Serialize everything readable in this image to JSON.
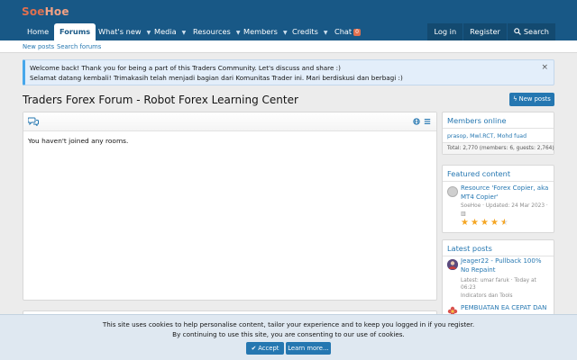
{
  "site": {
    "logo_primary": "Soe",
    "logo_secondary": "Hoe"
  },
  "nav": {
    "items": [
      {
        "label": "Home"
      },
      {
        "label": "Forums",
        "active": true
      },
      {
        "label": "What's new"
      },
      {
        "label": "Media"
      },
      {
        "label": "Resources"
      },
      {
        "label": "Members"
      },
      {
        "label": "Credits"
      },
      {
        "label": "Chat",
        "badge": "0"
      }
    ],
    "login": "Log in",
    "register": "Register",
    "search": "Search"
  },
  "subnav": {
    "new_posts": "New posts",
    "search_forums": "Search forums"
  },
  "notice": {
    "line1": "Welcome back! Thank you for being a part of this Traders Community. Let's discuss and share :)",
    "line2": "Selamat datang kembali! Trimakasih telah menjadi bagian dari Komunitas Trader ini. Mari berdiskusi dan berbagi :)",
    "close": "×"
  },
  "page": {
    "title": "Traders Forex Forum - Robot Forex Learning Center",
    "new_posts_button": "New posts"
  },
  "chat": {
    "message": "You haven't joined any rooms."
  },
  "sidebar": {
    "members_online": {
      "title": "Members online",
      "members": "prasop, Mwl.RCT, Mohd fuad",
      "total": "Total: 2,770 (members: 6, guests: 2,764)"
    },
    "featured": {
      "title": "Featured content",
      "item_title": "Resource 'Forex Copier, aka MT4 Copier'",
      "item_meta": "SoeHoe · Updated: 24 Mar 2023 ·",
      "rating_stars": 4.5
    },
    "latest": {
      "title": "Latest posts",
      "posts": [
        {
          "title": "Jeager22 - Pullback 100% No Repaint",
          "meta": "Latest: umar faruk · Today at 06:23",
          "forum": "Indicators dan Tools"
        },
        {
          "title": "PEMBUATAN EA CEPAT DAN"
        }
      ]
    }
  },
  "cookie": {
    "line1": "This site uses cookies to help personalise content, tailor your experience and to keep you logged in if you register.",
    "line2": "By continuing to use this site, you are consenting to our use of cookies.",
    "accept": "Accept",
    "learn_more": "Learn more…"
  },
  "colors": {
    "header": "#185886",
    "accent": "#2577b1",
    "logo": "#e0704f",
    "notice_bg": "#e3eefa",
    "star": "#f5a623"
  }
}
